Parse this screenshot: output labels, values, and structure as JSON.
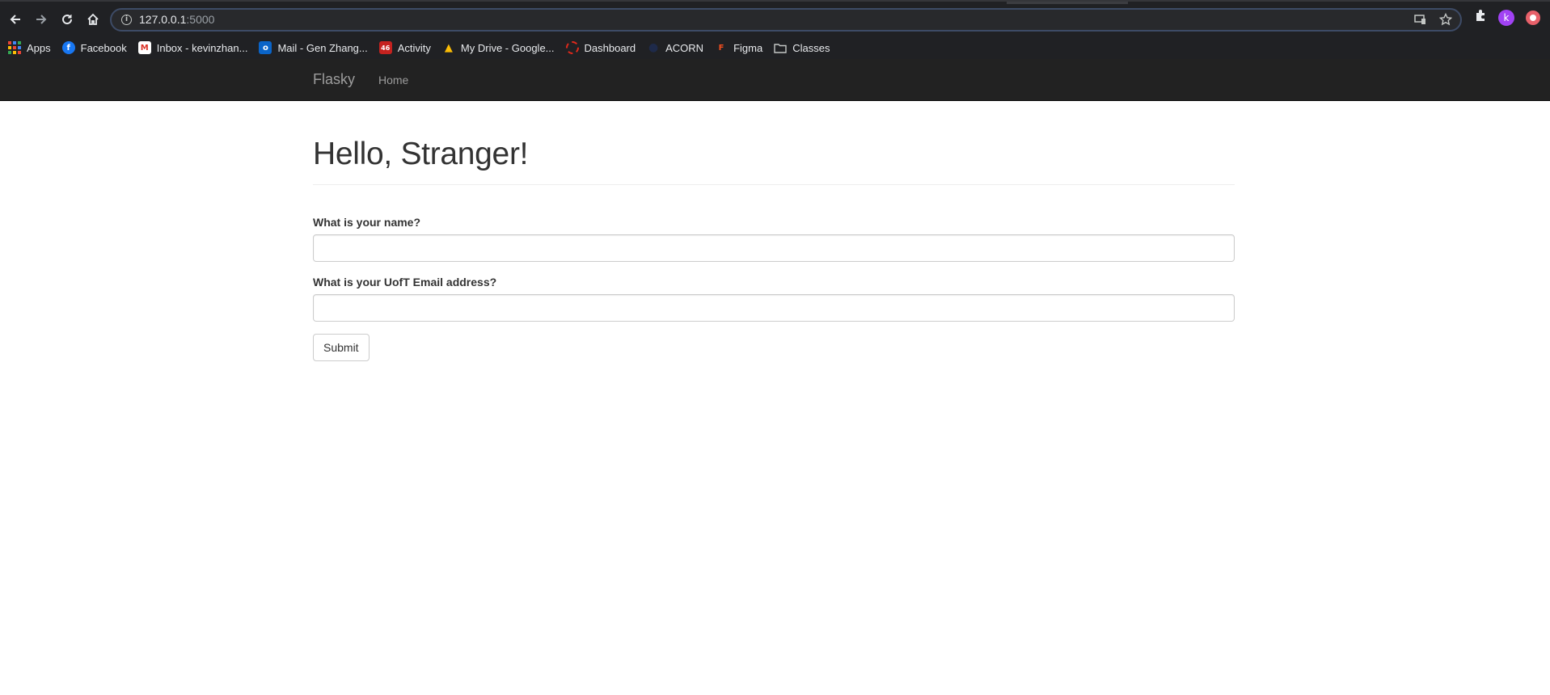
{
  "browser": {
    "url_host": "127.0.0.1",
    "url_port": ":5000",
    "icons": [
      "back-icon",
      "forward-icon",
      "reload-icon",
      "home-icon",
      "site-info-icon",
      "cast-icon",
      "star-icon",
      "extensions-icon",
      "profile-avatar",
      "extension-icon"
    ],
    "profile_initial": "k"
  },
  "bookmarks": [
    {
      "label": "Apps",
      "icon": "apps-grid-icon"
    },
    {
      "label": "Facebook",
      "icon": "facebook-icon",
      "color": "#1877f2",
      "glyph": "f"
    },
    {
      "label": "Inbox - kevinzhan...",
      "icon": "gmail-icon",
      "color": "#d93025",
      "glyph": "M"
    },
    {
      "label": "Mail - Gen Zhang...",
      "icon": "outlook-icon",
      "color": "#0a64c8",
      "glyph": "o"
    },
    {
      "label": "Activity",
      "icon": "calendar-icon",
      "color": "#c5221f",
      "glyph": "46"
    },
    {
      "label": "My Drive - Google...",
      "icon": "drive-icon",
      "color": "#1fa463",
      "glyph": "▲"
    },
    {
      "label": "Dashboard",
      "icon": "dashboard-icon",
      "color": "#e0291b",
      "glyph": "◌"
    },
    {
      "label": "ACORN",
      "icon": "acorn-icon",
      "color": "#1e2a4a",
      "glyph": "●"
    },
    {
      "label": "Figma",
      "icon": "figma-icon",
      "color": "#f24e1e",
      "glyph": "F"
    },
    {
      "label": "Classes",
      "icon": "folder-icon",
      "color": "#9aa0a6",
      "glyph": "▭"
    }
  ],
  "navbar": {
    "brand": "Flasky",
    "links": [
      "Home"
    ]
  },
  "main": {
    "heading": "Hello, Stranger!",
    "name_label": "What is your name?",
    "name_value": "",
    "email_label": "What is your UofT Email address?",
    "email_value": "",
    "submit_label": "Submit"
  }
}
